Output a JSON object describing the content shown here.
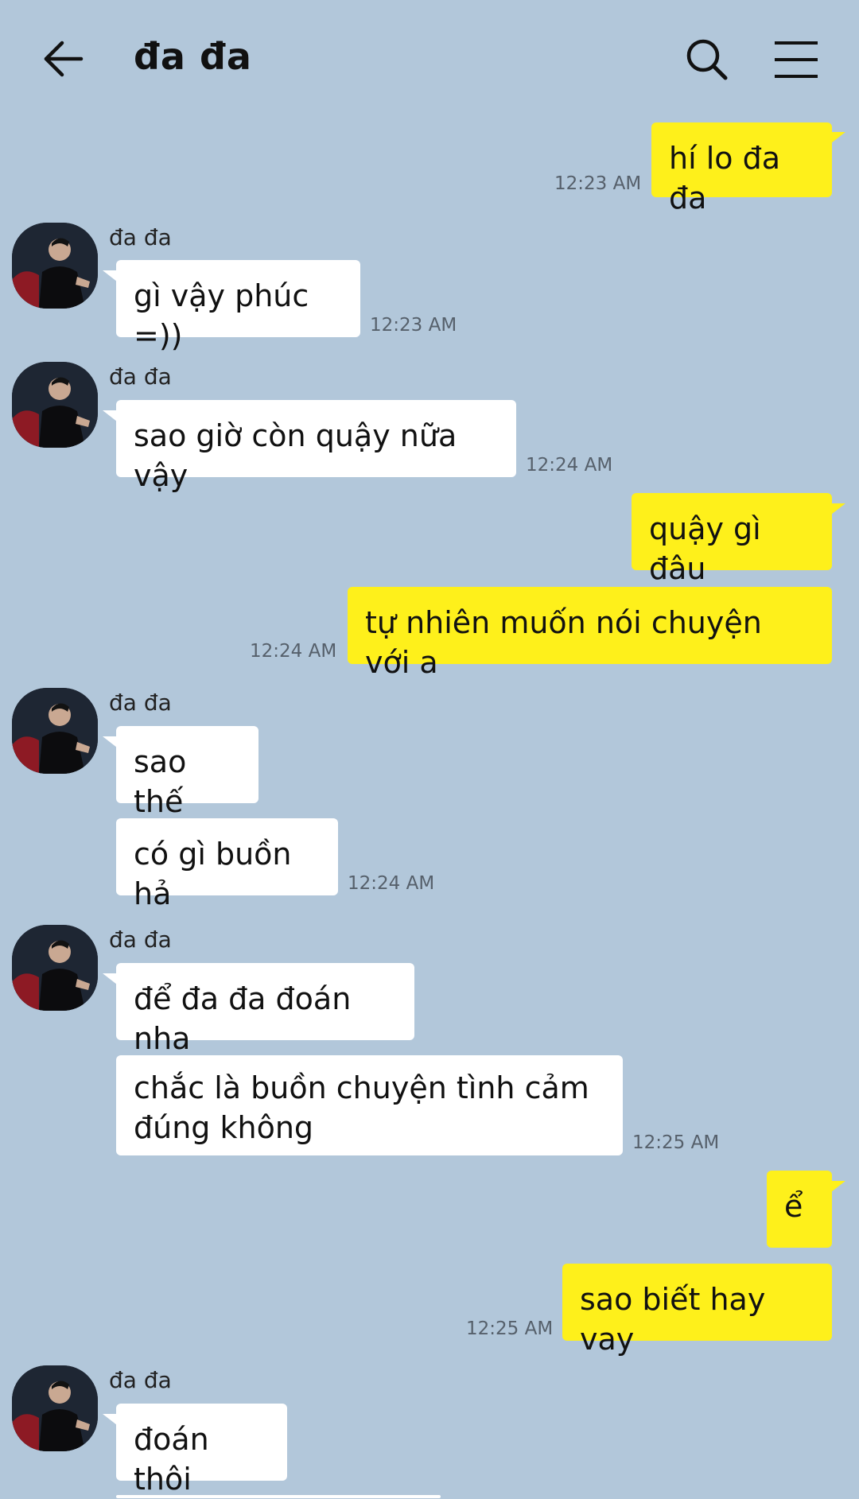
{
  "header": {
    "title": "đa đa",
    "back_icon": "arrow-left-icon",
    "search_icon": "search-icon",
    "menu_icon": "menu-icon"
  },
  "colors": {
    "background": "#b2c7da",
    "incoming_bubble": "#ffffff",
    "outgoing_bubble": "#fef01b",
    "timestamp": "#56606b"
  },
  "contact": {
    "name": "đa đa",
    "avatar_icon": "avatar-icon"
  },
  "messages": [
    {
      "from": "me",
      "text": "hí lo đa đa",
      "time": "12:23 AM"
    },
    {
      "from": "đa đa",
      "text": "gì vậy phúc =))",
      "time": "12:23 AM"
    },
    {
      "from": "đa đa",
      "text": "sao giờ còn quậy nữa vậy",
      "time": "12:24 AM"
    },
    {
      "from": "me",
      "text": "quậy gì đâu",
      "time": ""
    },
    {
      "from": "me",
      "text": "tự nhiên muốn nói chuyện với a",
      "time": "12:24 AM"
    },
    {
      "from": "đa đa",
      "text": "sao thế",
      "time": ""
    },
    {
      "from": "đa đa",
      "text": "có gì buồn hả",
      "time": "12:24 AM"
    },
    {
      "from": "đa đa",
      "text": "để đa đa đoán nha",
      "time": ""
    },
    {
      "from": "đa đa",
      "text": "chắc là buồn chuyện tình cảm\nđúng không",
      "time": "12:25 AM"
    },
    {
      "from": "me",
      "text": "ể",
      "time": ""
    },
    {
      "from": "me",
      "text": "sao biết hay vay",
      "time": "12:25 AM"
    },
    {
      "from": "đa đa",
      "text": "đoán thôi",
      "time": ""
    }
  ]
}
